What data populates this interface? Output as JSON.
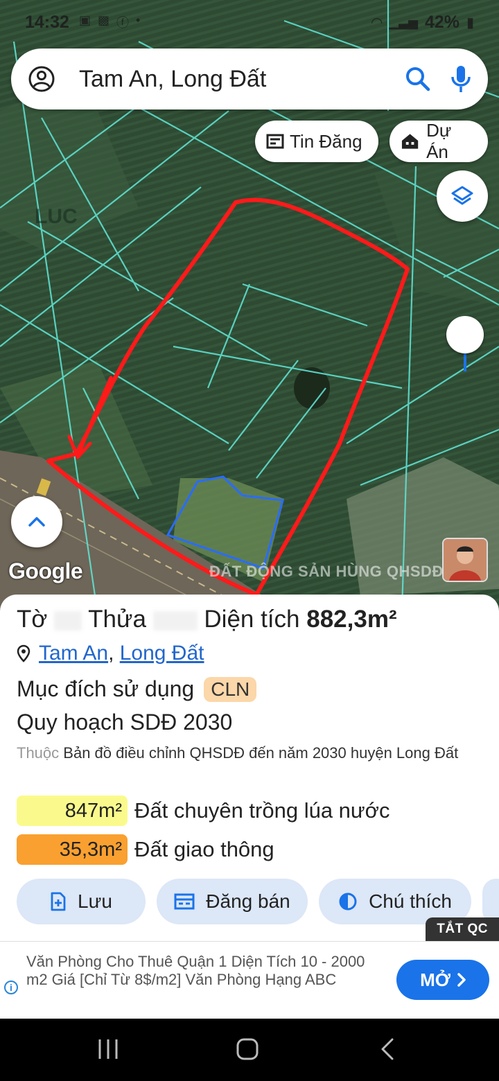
{
  "status_bar": {
    "time": "14:32",
    "battery": "42%"
  },
  "search": {
    "query": "Tam An, Long Đất"
  },
  "chips": {
    "listings": "Tin Đăng",
    "projects": "Dự Án"
  },
  "map": {
    "parcel_label": "LUC",
    "google_logo": "Google",
    "watermark": "ĐẤT ĐỘNG SẢN HÙNG QHSDĐ 2030"
  },
  "parcel": {
    "sheet_label": "Tờ",
    "plot_label": "Thửa",
    "area_label": "Diện tích",
    "area_value": "882,3m²",
    "location_1": "Tam An",
    "location_2": "Long Đất",
    "purpose_label": "Mục đích sử dụng",
    "purpose_code": "CLN",
    "plan_title": "Quy hoạch SDĐ 2030",
    "belongs_label": "Thuộc",
    "belongs_text": "Bản đồ điều chỉnh QHSDĐ đến năm 2030 huyện Long Đất",
    "land_uses": [
      {
        "area": "847m²",
        "name": "Đất chuyên trồng lúa nước",
        "color": "#fafa8c"
      },
      {
        "area": "35,3m²",
        "name": "Đất giao thông",
        "color": "#f9a030"
      }
    ]
  },
  "actions": {
    "save": "Lưu",
    "post": "Đăng bán",
    "legend": "Chú thích"
  },
  "ad": {
    "tag": "TẮT QC",
    "text": "Văn Phòng Cho Thuê Quận 1 Diện Tích 10 - 2000 m2 Giá [Chỉ Từ 8$/m2] Văn Phòng Hạng ABC",
    "open_label": "MỞ"
  },
  "colors": {
    "accent": "#1a73e8",
    "parcel_outline": "#ff1a1a",
    "boundary_lines": "#5fe0d0"
  }
}
